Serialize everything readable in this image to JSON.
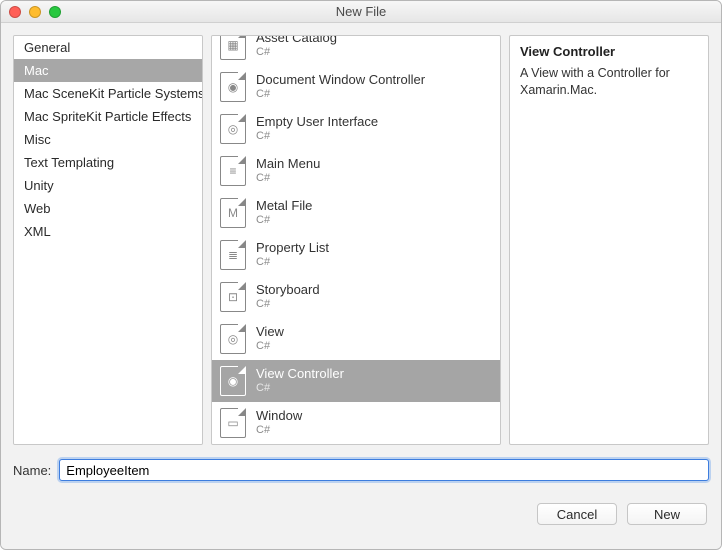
{
  "window": {
    "title": "New File"
  },
  "sidebar": {
    "categories": [
      {
        "label": "General",
        "selected": false
      },
      {
        "label": "Mac",
        "selected": true
      },
      {
        "label": "Mac SceneKit Particle Systems",
        "selected": false
      },
      {
        "label": "Mac SpriteKit Particle Effects",
        "selected": false
      },
      {
        "label": "Misc",
        "selected": false
      },
      {
        "label": "Text Templating",
        "selected": false
      },
      {
        "label": "Unity",
        "selected": false
      },
      {
        "label": "Web",
        "selected": false
      },
      {
        "label": "XML",
        "selected": false
      }
    ]
  },
  "templates": {
    "items": [
      {
        "name": "Asset Catalog",
        "subtitle": "C#",
        "glyph": "▦",
        "selected": false
      },
      {
        "name": "Document Window Controller",
        "subtitle": "C#",
        "glyph": "◉",
        "selected": false
      },
      {
        "name": "Empty User Interface",
        "subtitle": "C#",
        "glyph": "◎",
        "selected": false
      },
      {
        "name": "Main Menu",
        "subtitle": "C#",
        "glyph": "≡",
        "selected": false
      },
      {
        "name": "Metal File",
        "subtitle": "C#",
        "glyph": "M",
        "selected": false
      },
      {
        "name": "Property List",
        "subtitle": "C#",
        "glyph": "≣",
        "selected": false
      },
      {
        "name": "Storyboard",
        "subtitle": "C#",
        "glyph": "⊡",
        "selected": false
      },
      {
        "name": "View",
        "subtitle": "C#",
        "glyph": "◎",
        "selected": false
      },
      {
        "name": "View Controller",
        "subtitle": "C#",
        "glyph": "◉",
        "selected": true
      },
      {
        "name": "Window",
        "subtitle": "C#",
        "glyph": "▭",
        "selected": false
      }
    ]
  },
  "details": {
    "title": "View Controller",
    "body": "A View with a Controller for Xamarin.Mac."
  },
  "name": {
    "label": "Name:",
    "value": "EmployeeItem"
  },
  "footer": {
    "cancel": "Cancel",
    "new": "New"
  }
}
